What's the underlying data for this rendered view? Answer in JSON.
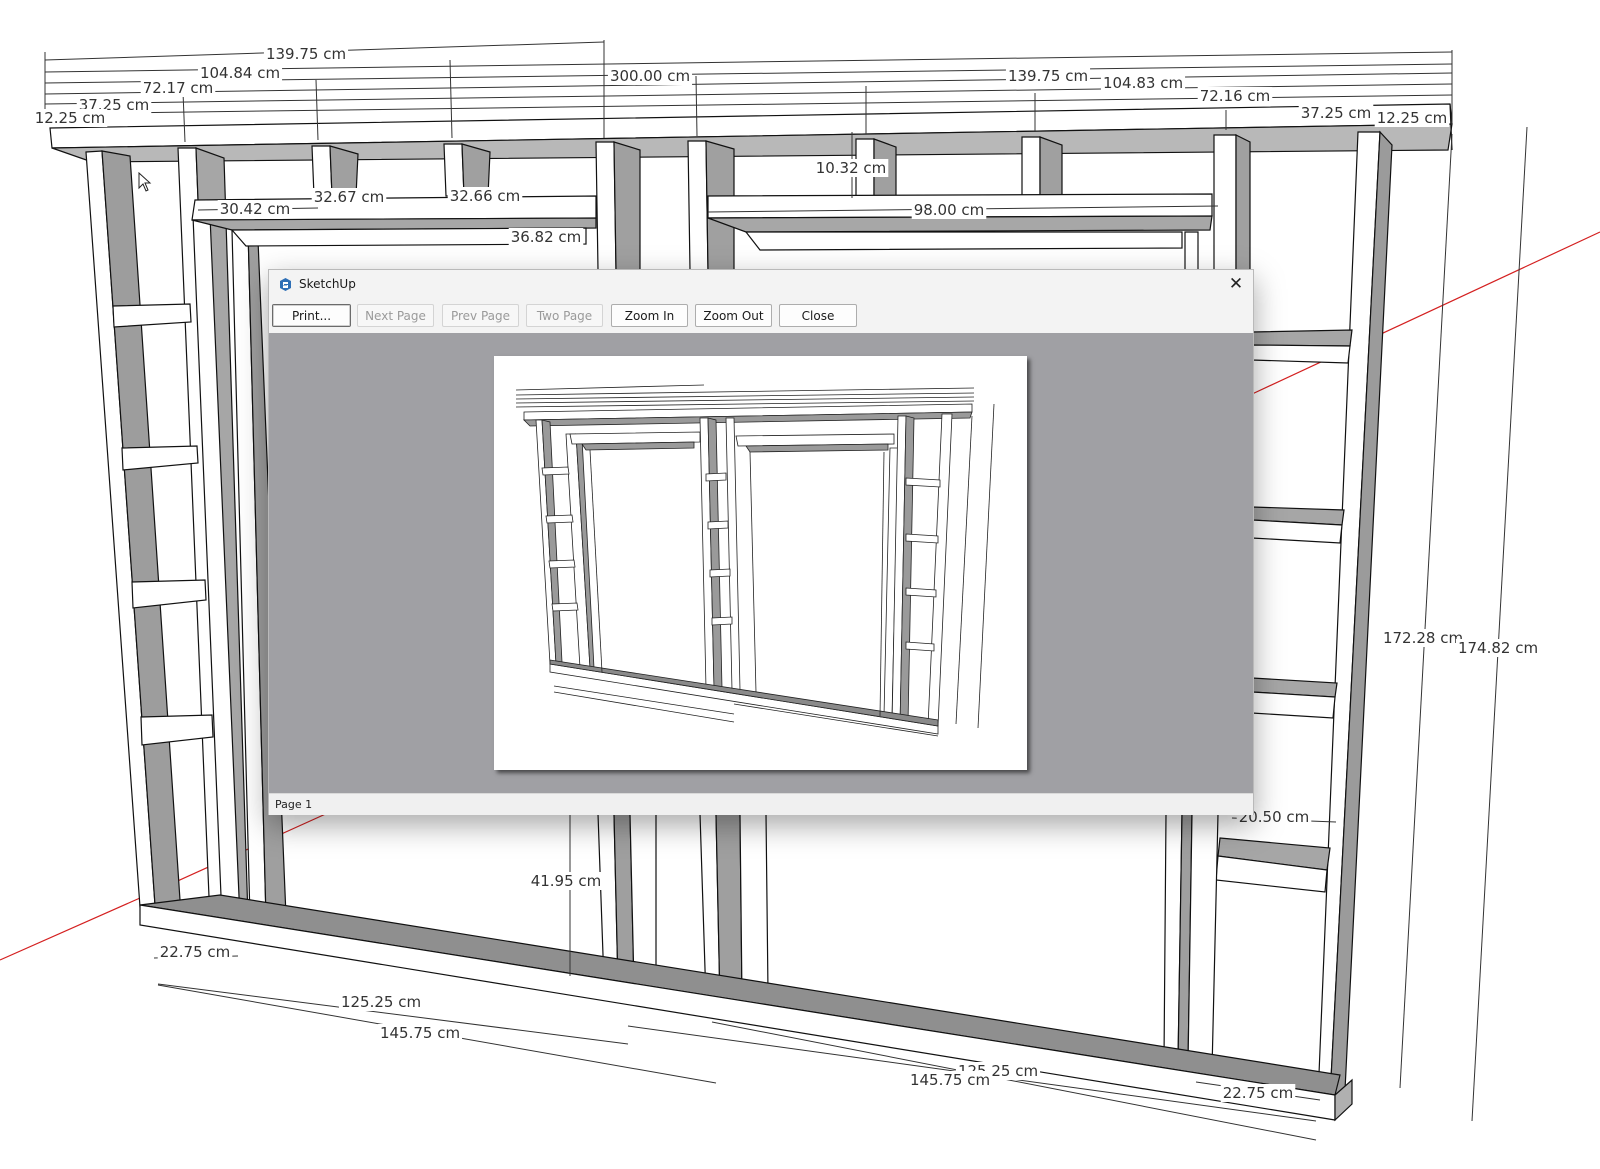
{
  "dialog": {
    "title": "SketchUp",
    "close_glyph": "✕",
    "toolbar": {
      "print": "Print...",
      "next_page": "Next Page",
      "prev_page": "Prev Page",
      "two_page": "Two Page",
      "zoom_in": "Zoom In",
      "zoom_out": "Zoom Out",
      "close": "Close"
    },
    "status": "Page 1"
  },
  "model": {
    "dimensions": {
      "top_139_75_left": "139.75 cm",
      "top_104_84": "104.84 cm",
      "top_72_17": "72.17 cm",
      "top_37_25_left": "37.25 cm",
      "top_12_25_left": "12.25 cm",
      "top_300_00": "300.00 cm",
      "top_139_75_right": "139.75 cm",
      "top_104_83": "104.83 cm",
      "top_72_16": "72.16 cm",
      "top_37_25_right": "37.25 cm",
      "top_12_25_right": "12.25 cm",
      "d_10_32": "10.32 cm",
      "d_30_42": "30.42 cm",
      "d_32_67": "32.67 cm",
      "d_32_66": "32.66 cm",
      "d_98_00": "98.00 cm",
      "d_36_82": "36.82 cm",
      "d_172_28": "172.28 cm",
      "d_174_82": "174.82 cm",
      "d_20_50": "20.50 cm",
      "d_41_95": "41.95 cm",
      "d_22_75_left": "22.75 cm",
      "d_125_25_left": "125.25 cm",
      "d_145_75_left": "145.75 cm",
      "d_125_25_right": "125.25 cm",
      "d_145_75_right": "145.75 cm",
      "d_22_75_right": "22.75 cm"
    }
  },
  "icons": {
    "app": "sketchup-logo-icon",
    "cursor": "mouse-pointer-icon",
    "close": "close-icon"
  },
  "colors": {
    "preview_background": "#a0a0a4",
    "axis_red": "#d42020",
    "lumber_face": "#ffffff",
    "lumber_side": "#9b9b9b"
  }
}
